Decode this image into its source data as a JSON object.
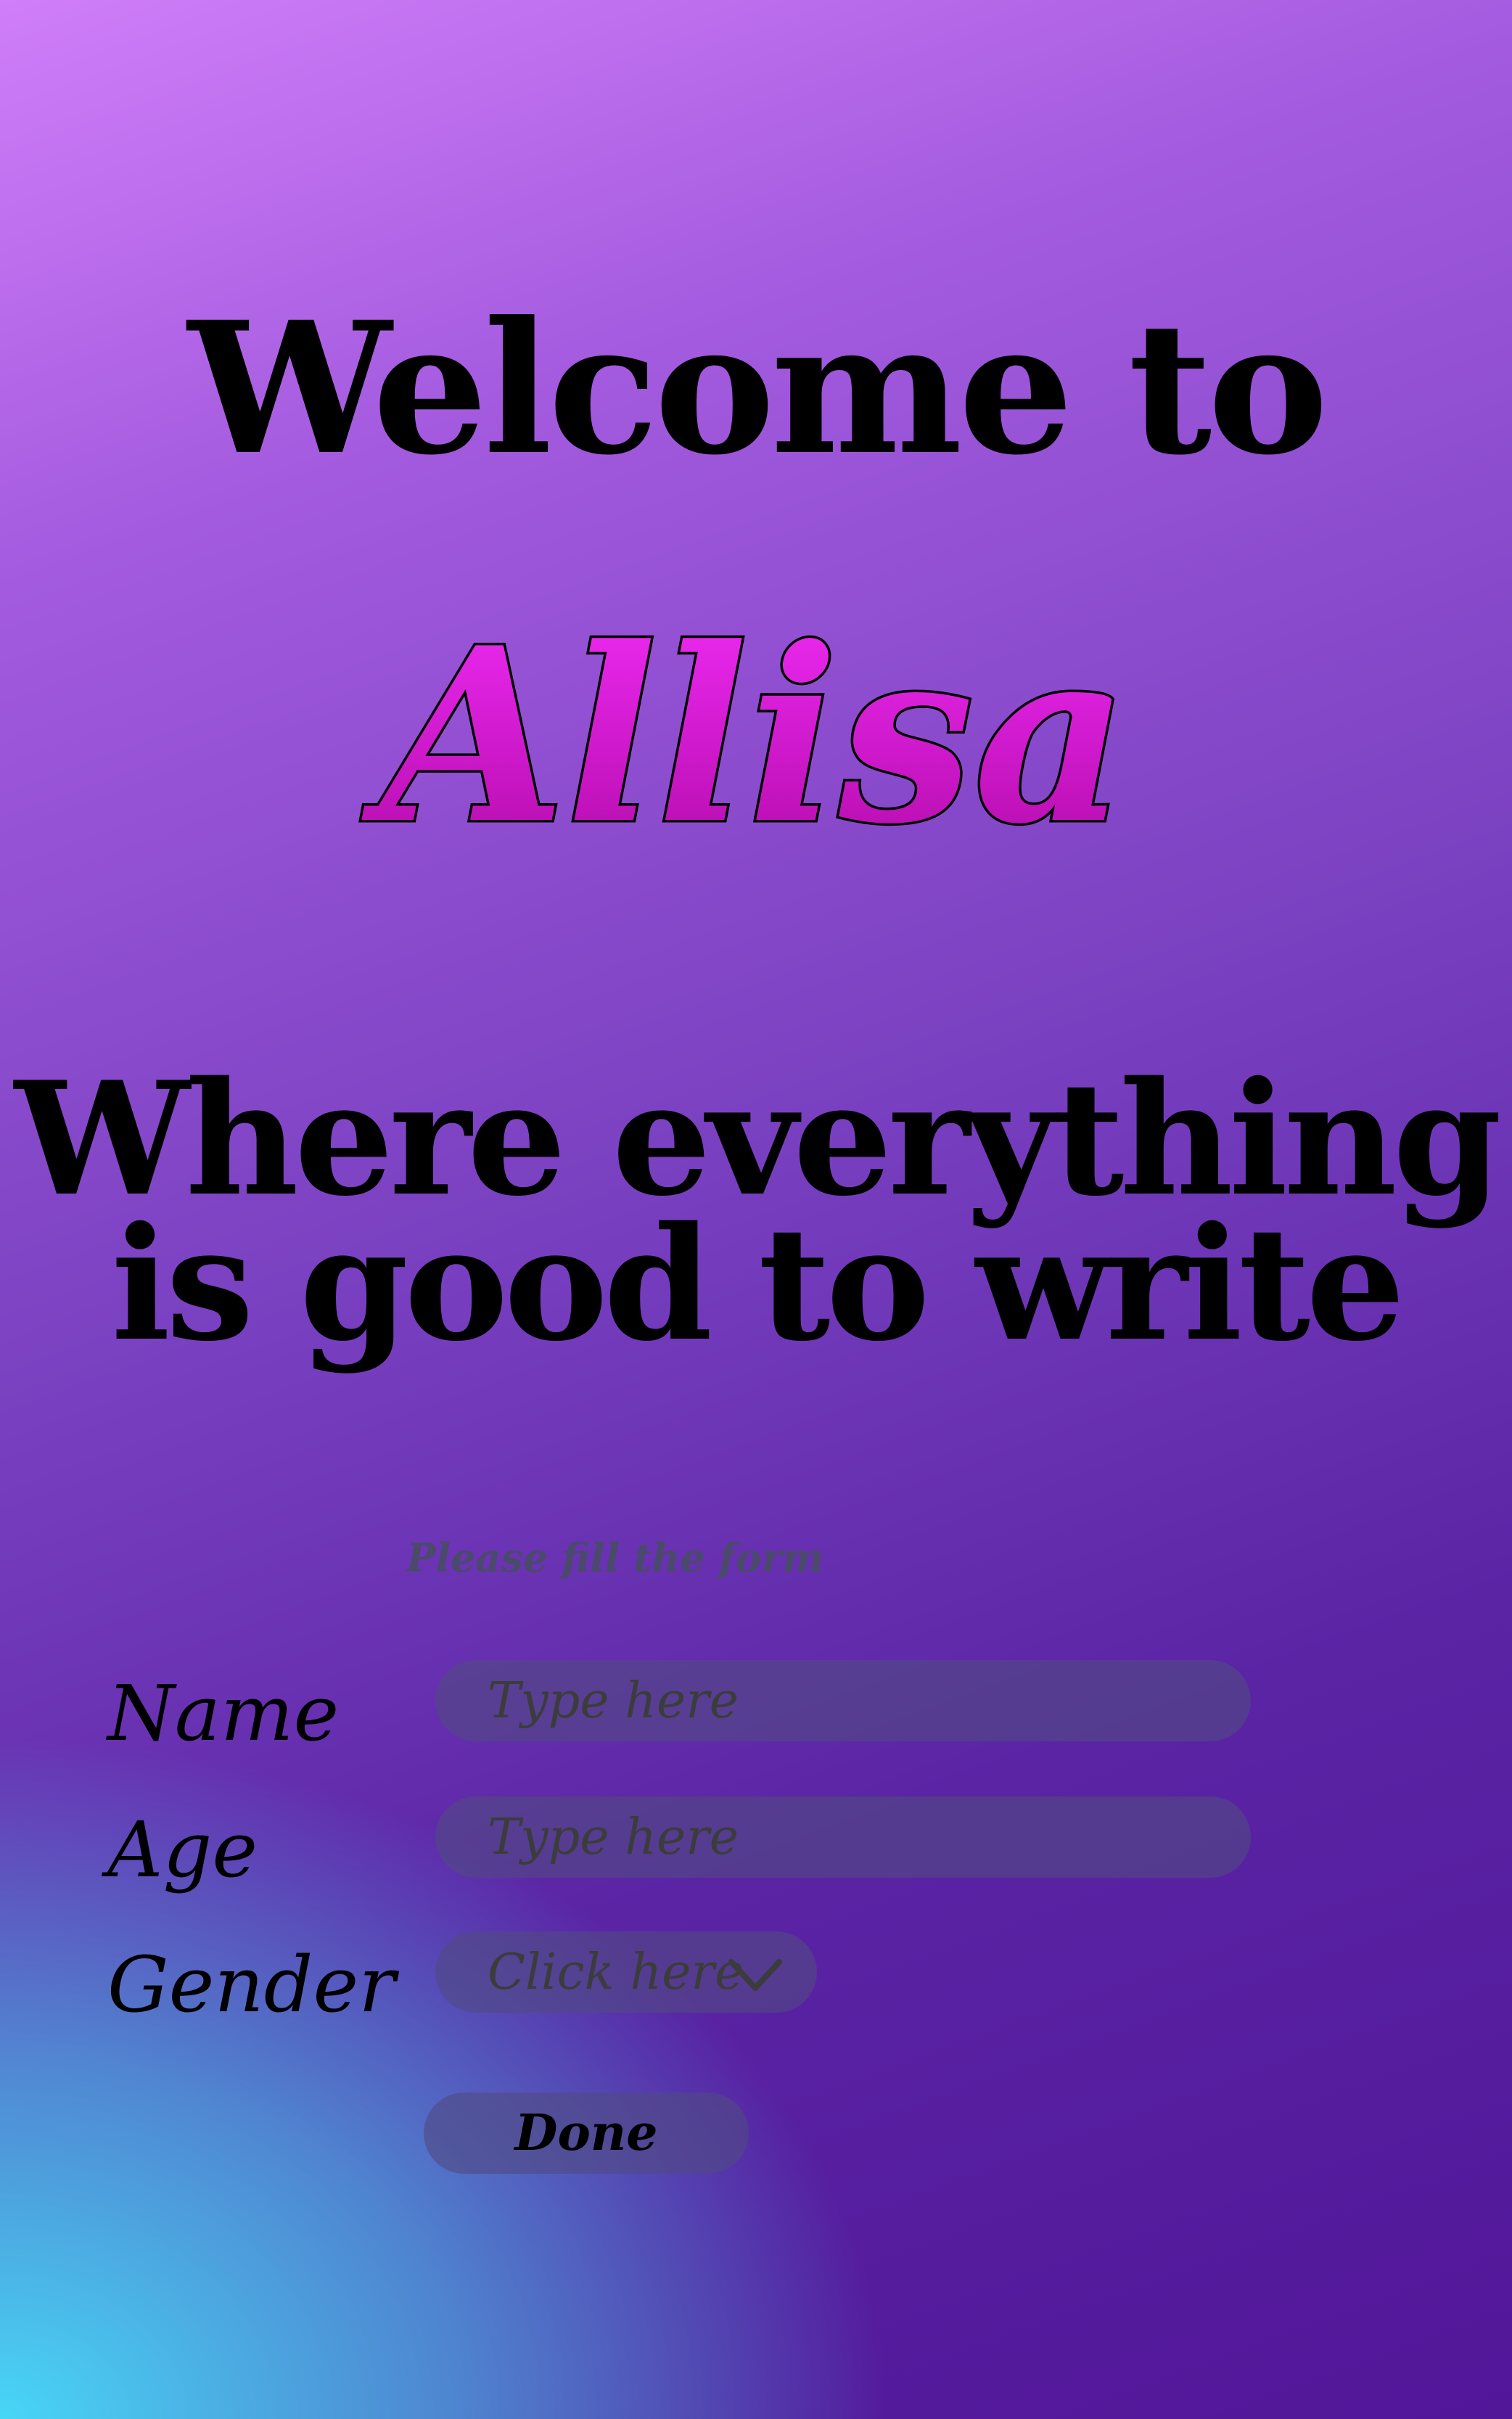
{
  "header": {
    "welcome_text": "Welcome to",
    "brand_name": "Allisa",
    "tagline_line1": "Where everything",
    "tagline_line2": "is good to write"
  },
  "form": {
    "hint": "Please fill the form",
    "fields": {
      "name": {
        "label": "Name",
        "placeholder": "Type here",
        "value": ""
      },
      "age": {
        "label": "Age",
        "placeholder": "Type here",
        "value": ""
      },
      "gender": {
        "label": "Gender",
        "selected": "Click here",
        "icon": "chevron-down-icon"
      }
    },
    "submit_label": "Done"
  },
  "colors": {
    "brand_fill_top": "#f02cf6",
    "brand_fill_bottom": "#b20aa8",
    "background_top_left": "#d07ef9",
    "background_top_right": "#521699",
    "background_bottom_left": "#48d6f6"
  }
}
